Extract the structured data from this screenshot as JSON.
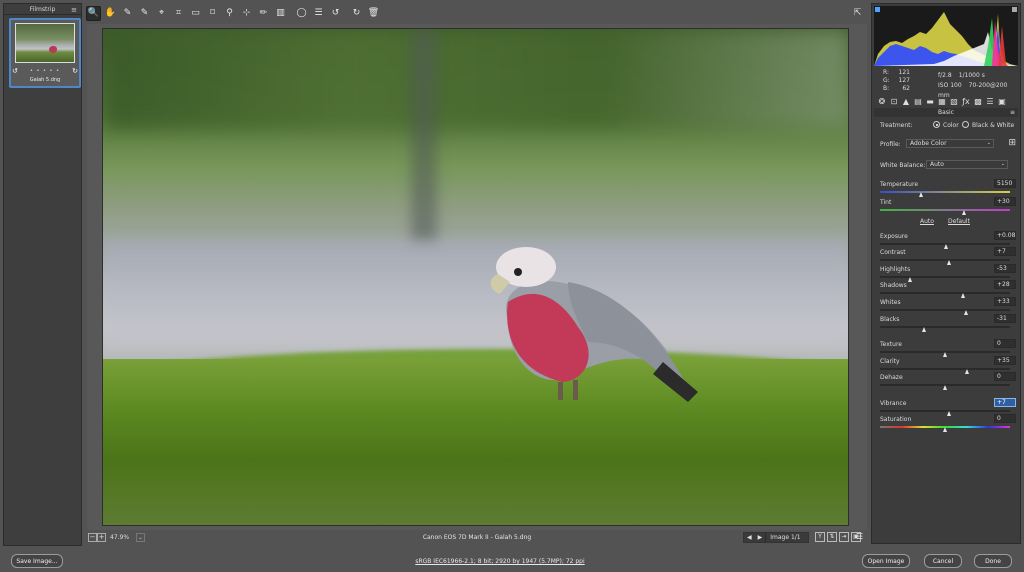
{
  "filmstrip": {
    "title": "Filmstrip",
    "items": [
      {
        "name": "Galah 5.dng",
        "stars": "• • • • •"
      }
    ]
  },
  "toolbar": {
    "tools": [
      {
        "name": "zoom-tool",
        "glyph": "🔍",
        "active": true
      },
      {
        "name": "hand-tool",
        "glyph": "✋",
        "active": false
      },
      {
        "name": "white-balance-tool",
        "glyph": "✎",
        "active": false
      },
      {
        "name": "color-sampler-tool",
        "glyph": "✎",
        "active": false
      },
      {
        "name": "targeted-adjustment-tool",
        "glyph": "⌖",
        "active": false
      },
      {
        "name": "crop-tool",
        "glyph": "⌗",
        "active": false
      },
      {
        "name": "straighten-tool",
        "glyph": "▭",
        "active": false
      },
      {
        "name": "transform-tool",
        "glyph": "⌑",
        "active": false
      },
      {
        "name": "spot-removal-tool",
        "glyph": "⚲",
        "active": false
      },
      {
        "name": "red-eye-tool",
        "glyph": "⊹",
        "active": false
      },
      {
        "name": "adjustment-brush-tool",
        "glyph": "✏",
        "active": false
      },
      {
        "name": "graduated-filter-tool",
        "glyph": "▥",
        "active": false
      },
      {
        "name": "radial-filter-tool",
        "glyph": "◯",
        "active": false
      },
      {
        "name": "preferences-tool",
        "glyph": "☰",
        "active": false
      },
      {
        "name": "rotate-ccw-tool",
        "glyph": "↺",
        "active": false
      },
      {
        "name": "rotate-cw-tool",
        "glyph": "↻",
        "active": false
      },
      {
        "name": "delete-tool",
        "glyph": "🗑",
        "active": false
      }
    ]
  },
  "canvas": {
    "zoom": "47.9%",
    "camera_file": "Canon EOS 7D Mark II  -  Galah 5.dng",
    "image_nav": "Image 1/1"
  },
  "histogram": {
    "readout": {
      "R": "121",
      "G": "127",
      "B": "62"
    },
    "aperture": "f/2.8",
    "shutter": "1/1000 s",
    "iso": "ISO 100",
    "lens": "70-200@200 mm"
  },
  "basic": {
    "section_title": "Basic",
    "treatment_label": "Treatment:",
    "treatment_color": "Color",
    "treatment_bw": "Black & White",
    "profile_label": "Profile:",
    "profile_value": "Adobe Color",
    "wb_label": "White Balance:",
    "wb_value": "Auto",
    "auto_link": "Auto",
    "default_link": "Default",
    "sliders": {
      "temperature": {
        "label": "Temperature",
        "value": "5150",
        "pos": 0.32
      },
      "tint": {
        "label": "Tint",
        "value": "+30",
        "pos": 0.65
      },
      "exposure": {
        "label": "Exposure",
        "value": "+0.08",
        "pos": 0.51
      },
      "contrast": {
        "label": "Contrast",
        "value": "+7",
        "pos": 0.535
      },
      "highlights": {
        "label": "Highlights",
        "value": "-53",
        "pos": 0.235
      },
      "shadows": {
        "label": "Shadows",
        "value": "+28",
        "pos": 0.64
      },
      "whites": {
        "label": "Whites",
        "value": "+33",
        "pos": 0.665
      },
      "blacks": {
        "label": "Blacks",
        "value": "-31",
        "pos": 0.345
      },
      "texture": {
        "label": "Texture",
        "value": "0",
        "pos": 0.5
      },
      "clarity": {
        "label": "Clarity",
        "value": "+35",
        "pos": 0.675
      },
      "dehaze": {
        "label": "Dehaze",
        "value": "0",
        "pos": 0.5
      },
      "vibrance": {
        "label": "Vibrance",
        "value": "+7",
        "pos": 0.535
      },
      "saturation": {
        "label": "Saturation",
        "value": "0",
        "pos": 0.5
      }
    }
  },
  "footer": {
    "save_image": "Save Image...",
    "workflow": "sRGB IEC61966-2.1; 8 bit; 2920 by 1947 (5.7MP); 72 ppi",
    "open_image": "Open Image",
    "cancel": "Cancel",
    "done": "Done"
  },
  "colors": {
    "accent": "#4d87c8",
    "panel_bg": "#3c3c3c",
    "app_bg": "#535353"
  }
}
